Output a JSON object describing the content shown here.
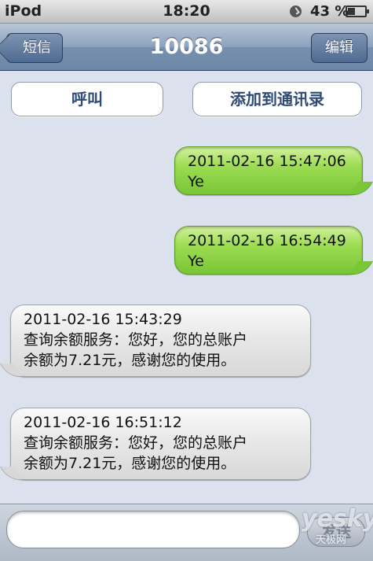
{
  "status_bar": {
    "carrier": "iPod",
    "time": "18:20",
    "battery": "43 %",
    "battery_level": 0.43
  },
  "nav": {
    "back_label": "短信",
    "title": "10086",
    "edit_label": "编辑"
  },
  "actions": {
    "call_label": "呼叫",
    "add_contact_label": "添加到通讯录"
  },
  "messages": [
    {
      "direction": "sent",
      "lines": [
        "2011-02-16 15:47:06",
        "Ye"
      ]
    },
    {
      "direction": "sent",
      "lines": [
        "2011-02-16 16:54:49",
        "Ye"
      ]
    },
    {
      "direction": "received",
      "lines": [
        "2011-02-16 15:43:29",
        "查询余额服务：您好，您的总账户",
        "余额为7.21元，感谢您的使用。"
      ]
    },
    {
      "direction": "received",
      "lines": [
        "2011-02-16 16:51:12",
        "查询余额服务：您好，您的总账户",
        "余额为7.21元，感谢您的使用。"
      ]
    }
  ],
  "compose": {
    "send_label": "发送"
  },
  "watermark": {
    "main": "yesky",
    "sub": "天极网"
  },
  "colors": {
    "sent_bubble": "#9ddc52",
    "received_bubble": "#e8e8e8",
    "nav_bar": "#7890af",
    "background": "#dbe2ed"
  }
}
